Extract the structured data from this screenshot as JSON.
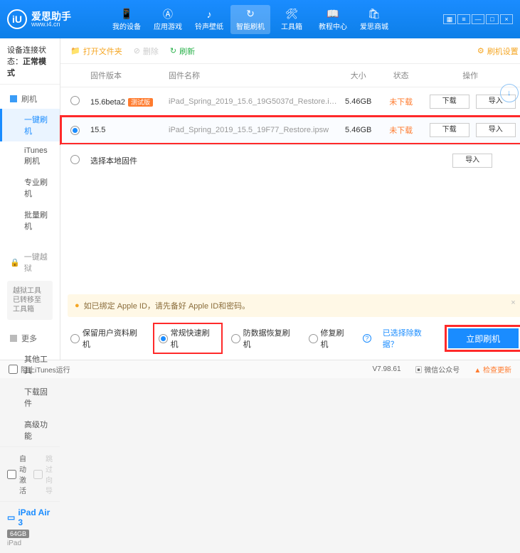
{
  "brand": {
    "cn": "爱思助手",
    "url": "www.i4.cn",
    "logo_letter": "iU"
  },
  "nav": {
    "items": [
      {
        "label": "我的设备"
      },
      {
        "label": "应用游戏"
      },
      {
        "label": "铃声壁纸"
      },
      {
        "label": "智能刷机"
      },
      {
        "label": "工具箱"
      },
      {
        "label": "教程中心"
      },
      {
        "label": "爱思商城"
      }
    ],
    "active_index": 3
  },
  "sidebar": {
    "status_label": "设备连接状态：",
    "status_value": "正常模式",
    "group_flash": "刷机",
    "items_flash": [
      "一键刷机",
      "iTunes刷机",
      "专业刷机",
      "批量刷机"
    ],
    "active_flash_index": 0,
    "group_jailbreak": "一键越狱",
    "jb_notice": "越狱工具已转移至工具箱",
    "group_more": "更多",
    "items_more": [
      "其他工具",
      "下载固件",
      "高级功能"
    ],
    "auto_activate": "自动激活",
    "skip_guide": "跳过向导",
    "device": {
      "name": "iPad Air 3",
      "storage": "64GB",
      "type": "iPad"
    }
  },
  "toolbar": {
    "open_folder": "打开文件夹",
    "delete": "删除",
    "refresh": "刷新",
    "flash_settings": "刷机设置"
  },
  "table": {
    "headers": {
      "version": "固件版本",
      "name": "固件名称",
      "size": "大小",
      "status": "状态",
      "ops": "操作"
    },
    "rows": [
      {
        "selected": false,
        "version": "15.6beta2",
        "beta_tag": "测试版",
        "name": "iPad_Spring_2019_15.6_19G5037d_Restore.i…",
        "size": "5.46GB",
        "status": "未下载",
        "download": "下载",
        "import": "导入"
      },
      {
        "selected": true,
        "version": "15.5",
        "beta_tag": "",
        "name": "iPad_Spring_2019_15.5_19F77_Restore.ipsw",
        "size": "5.46GB",
        "status": "未下载",
        "download": "下载",
        "import": "导入"
      }
    ],
    "local_firmware": "选择本地固件",
    "local_import": "导入"
  },
  "warning": "如已绑定 Apple ID，请先备好 Apple ID和密码。",
  "modes": {
    "keep_data": "保留用户资料刷机",
    "normal_fast": "常规快速刷机",
    "anti_recovery": "防数据恢复刷机",
    "repair": "修复刷机",
    "exclude_link": "已选择除数据？",
    "flash_button": "立即刷机",
    "selected_index": 1
  },
  "footer": {
    "block_itunes": "阻止iTunes运行",
    "version": "V7.98.61",
    "wechat": "微信公众号",
    "check_update": "检查更新"
  }
}
